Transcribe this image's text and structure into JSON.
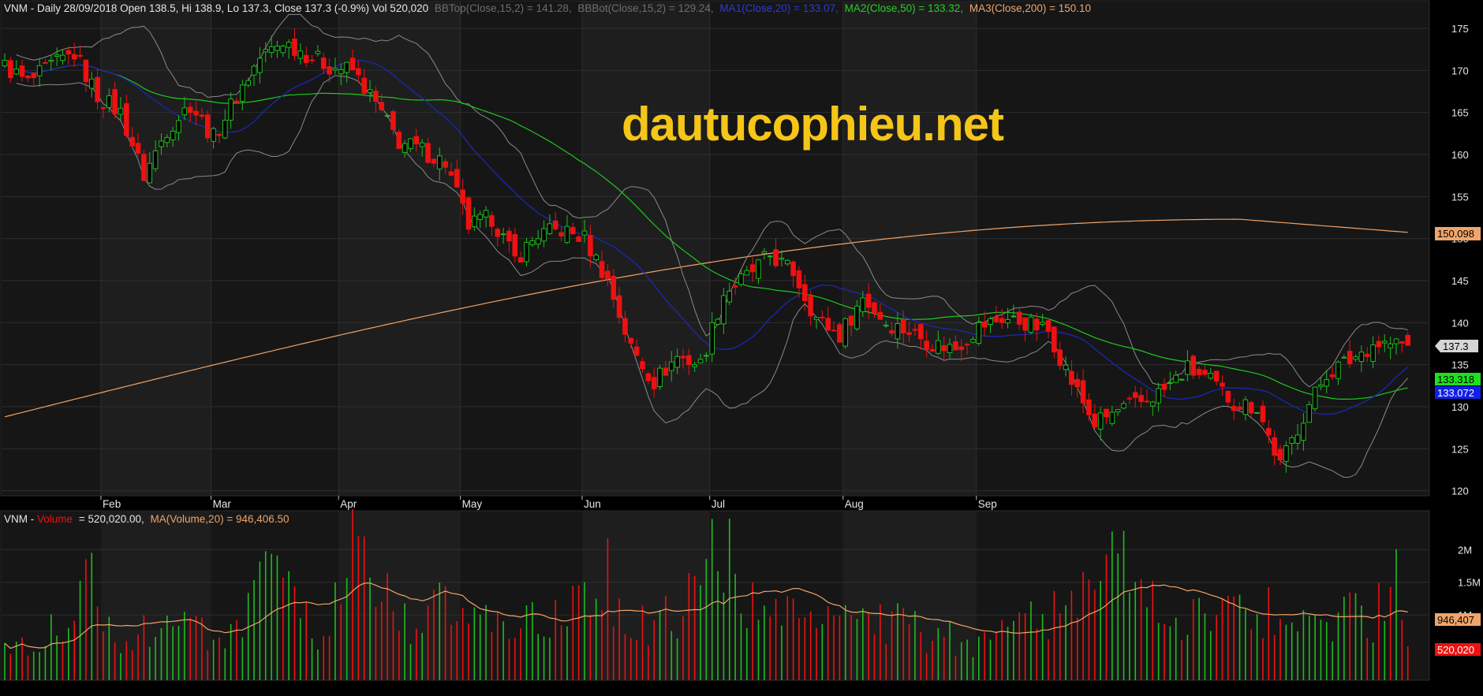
{
  "header": {
    "symbol": "VNM",
    "info": "Daily 28/09/2018 Open 138.5, Hi 138.9, Lo 137.3, Close 137.3 (-0.9%) Vol 520,020",
    "bbtop": "BBTop(Close,15,2) = 141.28,",
    "bbbot": "BBBot(Close,15,2) = 129.24,",
    "ma1": "MA1(Close,20) = 133.07,",
    "ma2": "MA2(Close,50) = 133.32,",
    "ma3": "MA3(Close,200) = 150.10"
  },
  "volume_header": {
    "symbol": "VNM",
    "label": "Volume",
    "value": "= 520,020.00,",
    "ma": "MA(Volume,20) = 946,406.50"
  },
  "watermark": "dautucophieu.net",
  "colors": {
    "background": "#000000",
    "panel": "#161616",
    "up": "#1dbd1d",
    "down": "#ee1111",
    "ma1": "#1a28b4",
    "ma2": "#1ec81e",
    "ma3": "#f0a46a",
    "bollinger": "#8a8a8a",
    "watermark": "#f5c518"
  },
  "right_axis_badges": {
    "ma3": "150.098",
    "close": "137.3",
    "ma2": "133.318",
    "ma1": "133.072",
    "vol_ma": "946,407",
    "vol": "520,020"
  },
  "chart_data": [
    {
      "type": "candlestick",
      "title": "VNM - Daily",
      "x_months": [
        "Feb",
        "Mar",
        "Apr",
        "May",
        "Jun",
        "Jul",
        "Aug",
        "Sep"
      ],
      "y_ticks": [
        120,
        125,
        130,
        135,
        140,
        145,
        150,
        155,
        160,
        165,
        170,
        175
      ],
      "ylim": [
        119.5,
        176.5
      ],
      "grid": true,
      "close_anchors": [
        [
          0,
          170.5
        ],
        [
          4,
          168.5
        ],
        [
          8,
          170.5
        ],
        [
          12,
          172.0
        ],
        [
          16,
          167.0
        ],
        [
          20,
          165.0
        ],
        [
          24,
          157.5
        ],
        [
          28,
          163.0
        ],
        [
          32,
          166.0
        ],
        [
          36,
          162.0
        ],
        [
          40,
          167.0
        ],
        [
          44,
          171.5
        ],
        [
          48,
          173.5
        ],
        [
          52,
          172.0
        ],
        [
          56,
          170.5
        ],
        [
          60,
          170.0
        ],
        [
          64,
          166.0
        ],
        [
          68,
          161.5
        ],
        [
          72,
          160.5
        ],
        [
          76,
          159.0
        ],
        [
          80,
          151.5
        ],
        [
          84,
          152.5
        ],
        [
          88,
          147.5
        ],
        [
          92,
          150.5
        ],
        [
          96,
          151.0
        ],
        [
          100,
          150.0
        ],
        [
          104,
          145.0
        ],
        [
          108,
          137.0
        ],
        [
          112,
          133.0
        ],
        [
          116,
          136.0
        ],
        [
          120,
          135.0
        ],
        [
          124,
          143.5
        ],
        [
          128,
          145.5
        ],
        [
          132,
          148.0
        ],
        [
          136,
          146.0
        ],
        [
          140,
          140.5
        ],
        [
          144,
          138.5
        ],
        [
          148,
          143.0
        ],
        [
          152,
          140.0
        ],
        [
          156,
          139.0
        ],
        [
          160,
          137.5
        ],
        [
          164,
          137.0
        ],
        [
          168,
          139.5
        ],
        [
          172,
          140.5
        ],
        [
          176,
          140.0
        ],
        [
          180,
          139.0
        ],
        [
          184,
          133.0
        ],
        [
          188,
          128.0
        ],
        [
          192,
          129.5
        ],
        [
          196,
          130.5
        ],
        [
          200,
          132.0
        ],
        [
          204,
          134.5
        ],
        [
          208,
          133.0
        ],
        [
          212,
          130.5
        ],
        [
          216,
          130.0
        ],
        [
          220,
          123.0
        ],
        [
          224,
          129.0
        ],
        [
          228,
          134.0
        ],
        [
          232,
          135.5
        ],
        [
          236,
          137.5
        ],
        [
          240,
          137.5
        ],
        [
          242,
          137.3
        ]
      ],
      "last_bar": {
        "date": "28/09/2018",
        "open": 138.5,
        "high": 138.9,
        "low": 137.3,
        "close": 137.3
      },
      "series": [
        {
          "name": "BBTop(Close,15,2)",
          "last": 141.28
        },
        {
          "name": "BBBot(Close,15,2)",
          "last": 129.24
        },
        {
          "name": "MA1(Close,20)",
          "last": 133.07
        },
        {
          "name": "MA2(Close,50)",
          "last": 133.32
        },
        {
          "name": "MA3(Close,200)",
          "last": 150.1
        }
      ]
    },
    {
      "type": "bar",
      "title": "VNM - Volume",
      "y_ticks": [
        "1M",
        "1.5M",
        "2M"
      ],
      "ylim": [
        0,
        2450000
      ],
      "volume_anchors": [
        [
          0,
          540000
        ],
        [
          10,
          850000
        ],
        [
          14,
          1800000
        ],
        [
          20,
          650000
        ],
        [
          30,
          900000
        ],
        [
          40,
          700000
        ],
        [
          45,
          1700000
        ],
        [
          55,
          620000
        ],
        [
          60,
          2000000
        ],
        [
          70,
          820000
        ],
        [
          75,
          1200000
        ],
        [
          80,
          950000
        ],
        [
          90,
          900000
        ],
        [
          100,
          1200000
        ],
        [
          104,
          1700000
        ],
        [
          108,
          900000
        ],
        [
          116,
          1000000
        ],
        [
          124,
          2300000
        ],
        [
          130,
          900000
        ],
        [
          136,
          1000000
        ],
        [
          140,
          800000
        ],
        [
          150,
          1000000
        ],
        [
          160,
          700000
        ],
        [
          170,
          600000
        ],
        [
          180,
          1100000
        ],
        [
          188,
          1400000
        ],
        [
          190,
          2400000
        ],
        [
          196,
          1200000
        ],
        [
          206,
          1000000
        ],
        [
          216,
          1100000
        ],
        [
          226,
          1000000
        ],
        [
          236,
          1000000
        ],
        [
          240,
          1900000
        ],
        [
          242,
          520020
        ]
      ],
      "last_volume": 520020,
      "ma_volume_last": 946406.5
    }
  ]
}
